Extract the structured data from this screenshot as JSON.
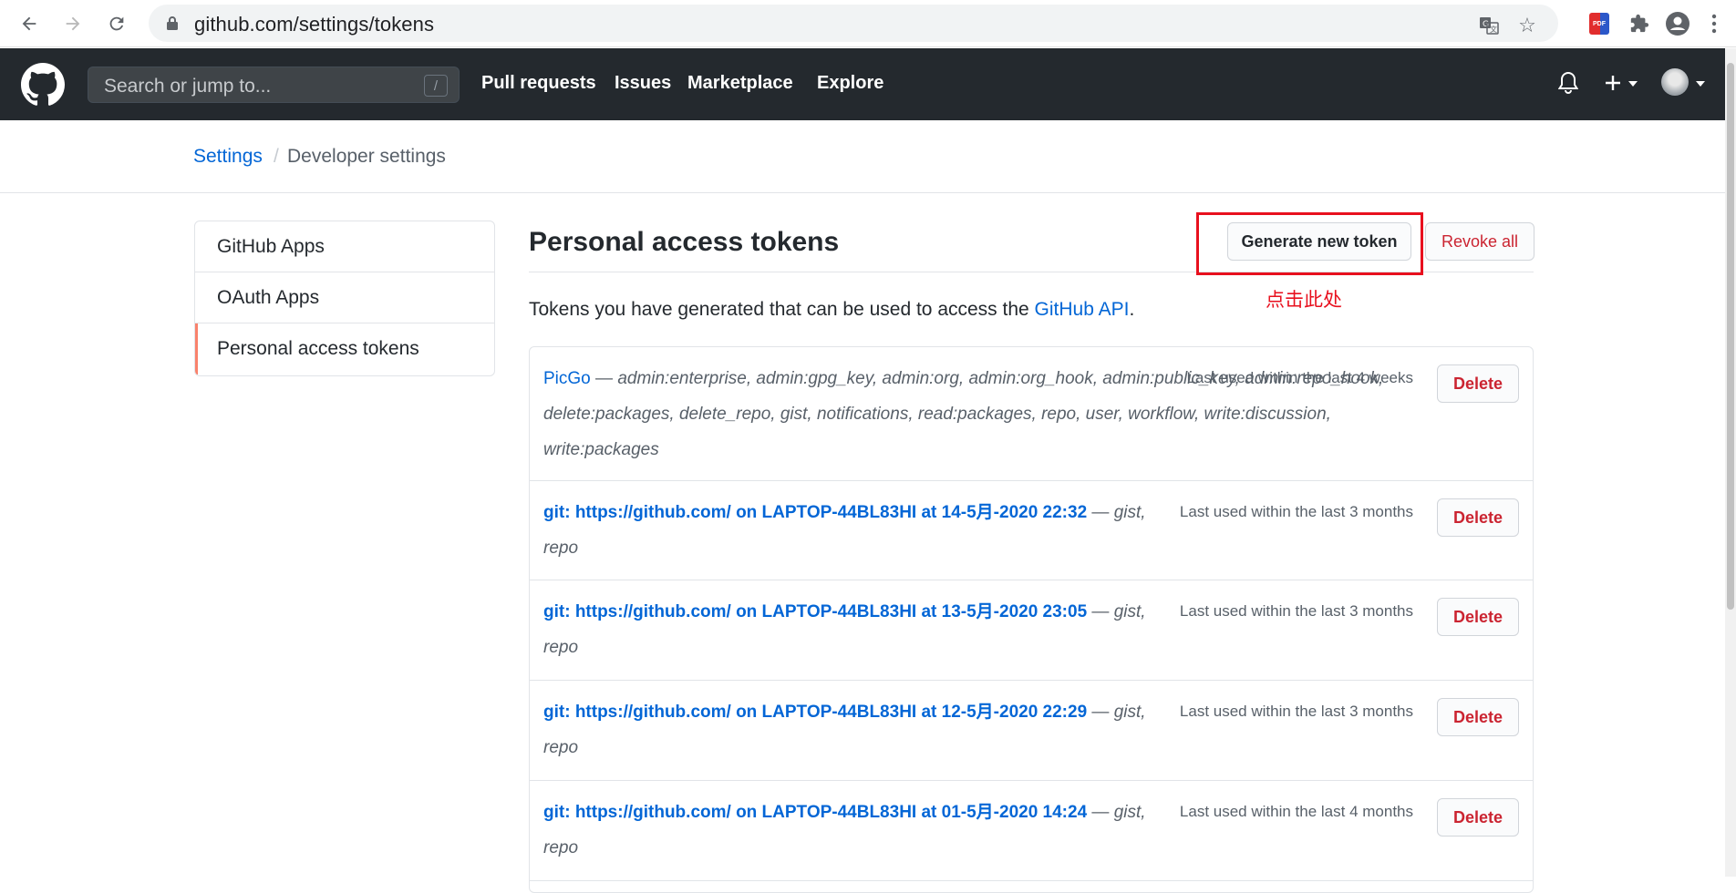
{
  "browser": {
    "url": "github.com/settings/tokens",
    "icons": [
      "back-icon",
      "forward-icon",
      "reload-icon",
      "lock-icon",
      "translate-icon",
      "star-icon",
      "pdf-extension-icon",
      "extensions-icon",
      "profile-icon",
      "menu-icon"
    ]
  },
  "header": {
    "search_placeholder": "Search or jump to...",
    "search_shortcut": "/",
    "nav": [
      "Pull requests",
      "Issues",
      "Marketplace",
      "Explore"
    ],
    "bg_color": "#24292e"
  },
  "breadcrumb": {
    "parent": "Settings",
    "separator": "/",
    "current": "Developer settings"
  },
  "sidebar": {
    "items": [
      {
        "label": "GitHub Apps"
      },
      {
        "label": "OAuth Apps"
      },
      {
        "label": "Personal access tokens",
        "active": true
      }
    ],
    "active_color": "#f9826c"
  },
  "main": {
    "title": "Personal access tokens",
    "generate_label": "Generate new token",
    "revoke_label": "Revoke all",
    "annotation": "点击此处",
    "annotation_color": "#e8101e",
    "desc_prefix": "Tokens you have generated that can be used to access the ",
    "desc_link": "GitHub API",
    "desc_suffix": "."
  },
  "tokens": [
    {
      "name": "PicGo",
      "dash": " — ",
      "scopes": "admin:enterprise, admin:gpg_key, admin:org, admin:org_hook, admin:public_key, admin:repo_hook, delete:packages, delete_repo, gist, notifications, read:packages, repo, user, workflow, write:discussion, write:packages",
      "last_used": "Last used within the last 4 weeks",
      "delete_label": "Delete"
    },
    {
      "name": "git: https://github.com/ on LAPTOP-44BL83HI at 14-5月-2020 22:32",
      "dash": " — ",
      "scopes": "gist, repo",
      "last_used": "Last used within the last 3 months",
      "delete_label": "Delete"
    },
    {
      "name": "git: https://github.com/ on LAPTOP-44BL83HI at 13-5月-2020 23:05",
      "dash": " — ",
      "scopes": "gist, repo",
      "last_used": "Last used within the last 3 months",
      "delete_label": "Delete"
    },
    {
      "name": "git: https://github.com/ on LAPTOP-44BL83HI at 12-5月-2020 22:29",
      "dash": " — ",
      "scopes": "gist, repo",
      "last_used": "Last used within the last 3 months",
      "delete_label": "Delete"
    },
    {
      "name": "git: https://github.com/ on LAPTOP-44BL83HI at 01-5月-2020 14:24",
      "dash": " — ",
      "scopes": "gist, repo",
      "last_used": "Last used within the last 4 months",
      "delete_label": "Delete"
    }
  ]
}
